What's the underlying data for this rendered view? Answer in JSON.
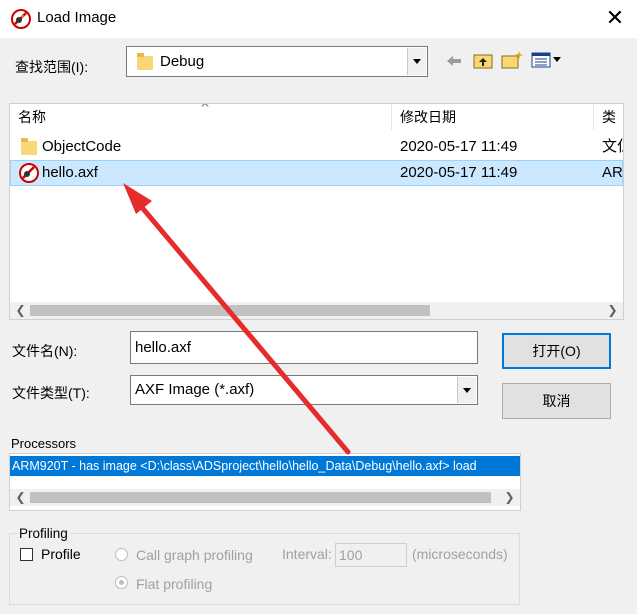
{
  "window": {
    "title": "Load Image",
    "close_glyph": "✕"
  },
  "lookin": {
    "label": "查找范围(I):",
    "value": "Debug"
  },
  "toolbar": {
    "back": "back-arrow-icon",
    "up": "up-folder-icon",
    "new_folder": "new-folder-icon",
    "view_menu": "view-menu-icon"
  },
  "filelist": {
    "columns": [
      {
        "label": "名称"
      },
      {
        "label": "修改日期"
      },
      {
        "label": "类"
      }
    ],
    "rows": [
      {
        "name": "ObjectCode",
        "date": "2020-05-17 11:49",
        "type": "文仁",
        "icon": "folder-icon",
        "selected": false
      },
      {
        "name": "hello.axf",
        "date": "2020-05-17 11:49",
        "type": "AR",
        "icon": "axf-file-icon",
        "selected": true
      }
    ]
  },
  "filename": {
    "label": "文件名(N):",
    "value": "hello.axf"
  },
  "filetype": {
    "label": "文件类型(T):",
    "value": "AXF Image (*.axf)"
  },
  "buttons": {
    "open": "打开(O)",
    "cancel": "取消"
  },
  "processors": {
    "label": "Processors",
    "items": [
      "ARM920T - has image <D:\\class\\ADSproject\\hello\\hello_Data\\Debug\\hello.axf> load"
    ]
  },
  "profiling": {
    "legend": "Profiling",
    "profile_label": "Profile",
    "profile_checked": false,
    "call_graph_label": "Call graph profiling",
    "flat_label": "Flat profiling",
    "flat_selected": true,
    "interval_label": "Interval:",
    "interval_value": "100",
    "units_label": "(microseconds)"
  },
  "colors": {
    "accent": "#0078d7",
    "selection": "#cce8ff",
    "annotation_arrow": "#e52b2b"
  }
}
